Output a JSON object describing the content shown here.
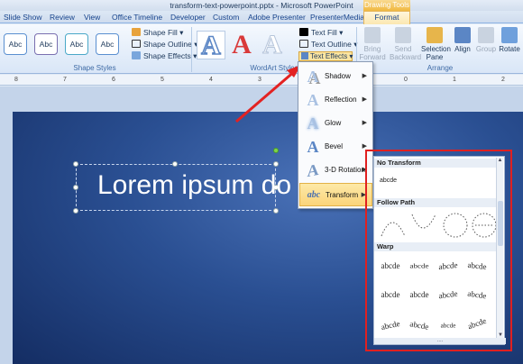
{
  "window": {
    "title": "transform-text-powerpoint.pptx - Microsoft PowerPoint",
    "contextual_tab": "Drawing Tools"
  },
  "tabs": [
    "Slide Show",
    "Review",
    "View",
    "Office Timeline",
    "Developer",
    "Custom",
    "Adobe Presenter",
    "PresenterMedia"
  ],
  "active_tab": "Format",
  "ribbon": {
    "shape_styles": {
      "thumbs": [
        "Abc",
        "Abc",
        "Abc",
        "Abc"
      ],
      "thumb_colors": [
        "#5a8fd0",
        "#7a6fb0",
        "#4aa8c8",
        "#5a8fd0"
      ],
      "shape_fill": "Shape Fill",
      "shape_outline": "Shape Outline",
      "shape_effects": "Shape Effects",
      "label": "Shape Styles"
    },
    "wordart_styles": {
      "letters": [
        "A",
        "A",
        "A"
      ],
      "letter_colors": [
        "#5b86c5",
        "#d93a3a",
        "#c8d6e8"
      ],
      "text_fill": "Text Fill",
      "text_outline": "Text Outline",
      "text_effects": "Text Effects",
      "label": "WordArt Styles"
    },
    "arrange": {
      "bring_forward": "Bring Forward",
      "send_backward": "Send Backward",
      "selection_pane": "Selection Pane",
      "align": "Align",
      "group": "Group",
      "rotate": "Rotate",
      "label": "Arrange"
    }
  },
  "ruler": [
    "8",
    "7",
    "6",
    "5",
    "4",
    "3",
    "2",
    "1",
    "0",
    "1",
    "2"
  ],
  "slide": {
    "text": "Lorem ipsum do"
  },
  "text_effects_menu": {
    "items": [
      {
        "label": "Shadow",
        "icon": "shadow-a-icon"
      },
      {
        "label": "Reflection",
        "icon": "reflection-a-icon"
      },
      {
        "label": "Glow",
        "icon": "glow-a-icon"
      },
      {
        "label": "Bevel",
        "icon": "bevel-a-icon"
      },
      {
        "label": "3-D Rotation",
        "icon": "rotation-3d-icon"
      },
      {
        "label": "Transform",
        "icon": "transform-abc-icon"
      }
    ],
    "active": "Transform"
  },
  "transform_gallery": {
    "no_transform_header": "No Transform",
    "no_transform_sample": "abcde",
    "follow_path_header": "Follow Path",
    "warp_header": "Warp",
    "warp_row1": [
      "abcde",
      "abcde",
      "abcde",
      "abcde"
    ],
    "warp_row2": [
      "abcde",
      "abcde",
      "abcde",
      "abcde"
    ],
    "warp_row3": [
      "abcde",
      "abcde",
      "abcde",
      "abcde"
    ],
    "grip": "...."
  }
}
